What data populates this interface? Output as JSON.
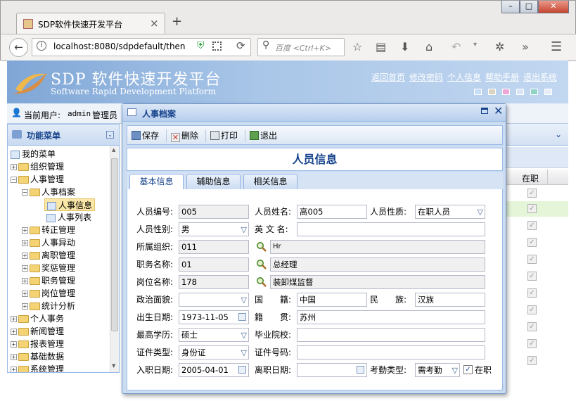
{
  "browser": {
    "tab_title": "SDP软件快速开发平台",
    "url": "localhost:8080/sdpdefault/then",
    "search_placeholder": "百度 <Ctrl+K>",
    "new_tab": "+",
    "close_tab": "×",
    "win_min": "–",
    "win_max": "□",
    "win_close": "✕"
  },
  "app": {
    "brand": "SDP 软件快速开发平台",
    "brand_en": "Software Rapid Development Platform",
    "top_links": [
      "返回首页",
      "修改密码",
      "个人信息",
      "帮助手册",
      "退出系统"
    ],
    "theme_colors": [
      "#c6ddf8",
      "#d9d4c2",
      "#f0a6d8",
      "#d9e4f4",
      "#8fd2c6",
      "#e9eef6"
    ],
    "current_user_label": "当前用户:",
    "current_user": "admin",
    "current_role": "管理员"
  },
  "sidebar": {
    "title": "功能菜单",
    "items": [
      {
        "label": "我的菜单"
      },
      {
        "label": "组织管理"
      },
      {
        "label": "人事管理"
      },
      {
        "label": "人事档案"
      },
      {
        "label": "人事信息"
      },
      {
        "label": "人事列表"
      },
      {
        "label": "转正管理"
      },
      {
        "label": "人事异动"
      },
      {
        "label": "离职管理"
      },
      {
        "label": "奖惩管理"
      },
      {
        "label": "职务管理"
      },
      {
        "label": "岗位管理"
      },
      {
        "label": "统计分析"
      },
      {
        "label": "个人事务"
      },
      {
        "label": "新闻管理"
      },
      {
        "label": "报表管理"
      },
      {
        "label": "基础数据"
      },
      {
        "label": "系统管理"
      }
    ]
  },
  "grid": {
    "header": "在职"
  },
  "dialog": {
    "title": "人事档案",
    "toolbar": {
      "save": "保存",
      "delete": "删除",
      "print": "打印",
      "exit": "退出"
    },
    "heading": "人员信息",
    "tabs": [
      "基本信息",
      "辅助信息",
      "相关信息"
    ],
    "labels": {
      "emp_no": "人员编号:",
      "name": "人员姓名:",
      "status": "人员性质:",
      "gender": "人员性别:",
      "en_name": "英 文 名:",
      "org": "所属组织:",
      "duty": "职务名称:",
      "post": "岗位名称:",
      "politics": "政治面貌:",
      "nationality": "国　　籍:",
      "ethnic": "民　　族:",
      "birth": "出生日期:",
      "native": "籍　　贯:",
      "edu": "最高学历:",
      "school": "毕业院校:",
      "id_type": "证件类型:",
      "id_no": "证件号码:",
      "join_date": "入职日期:",
      "leave_date": "离职日期:",
      "attend_type": "考勤类型:",
      "onjob": "在职"
    },
    "values": {
      "emp_no": "005",
      "name": "高005",
      "status": "在职人员",
      "gender": "男",
      "en_name": "",
      "org": "011",
      "org_name": "Hr",
      "duty": "01",
      "duty_name": "总经理",
      "post": "178",
      "post_name": "装卸煤监督",
      "politics": "",
      "nationality": "中国",
      "ethnic": "汉族",
      "birth": "1973-11-05",
      "native": "苏州",
      "edu": "硕士",
      "school": "",
      "id_type": "身份证",
      "id_no": "",
      "join_date": "2005-04-01",
      "leave_date": "",
      "attend_type": "需考勤",
      "onjob_checked": "✓"
    }
  }
}
